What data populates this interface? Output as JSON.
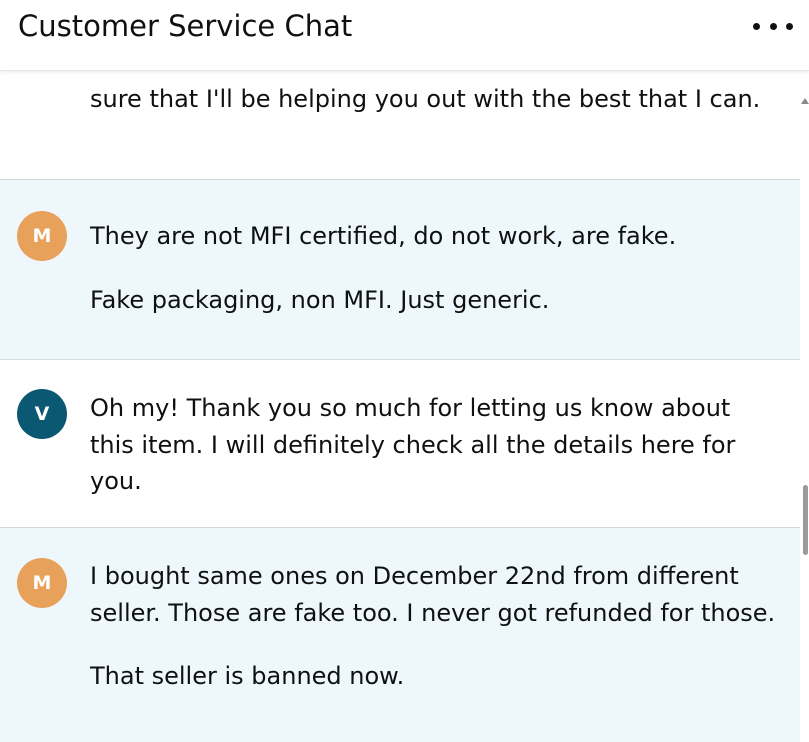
{
  "header": {
    "title": "Customer Service Chat",
    "menu_icon": "more-horizontal-icon"
  },
  "messages": [
    {
      "sender": "agent",
      "initial": "",
      "paragraphs": [
        "sure that I'll be helping you out with the best that I can."
      ]
    },
    {
      "sender": "customer",
      "initial": "M",
      "paragraphs": [
        "They are not MFI certified, do not work, are fake.",
        "Fake packaging, non MFI. Just generic."
      ]
    },
    {
      "sender": "agent",
      "initial": "V",
      "paragraphs": [
        "Oh my! Thank you so much for letting us know about this item. I will definitely check all the details here for you."
      ]
    },
    {
      "sender": "customer",
      "initial": "M",
      "paragraphs": [
        "I bought same ones on December 22nd from different seller. Those are fake too. I never got refunded for those.",
        "That seller is banned now."
      ]
    }
  ],
  "colors": {
    "customer_bubble": "#eef8fc",
    "agent_bubble": "#ffffff",
    "customer_avatar": "#e8a15a",
    "agent_avatar": "#0b5872",
    "divider": "#d5d9d9"
  }
}
